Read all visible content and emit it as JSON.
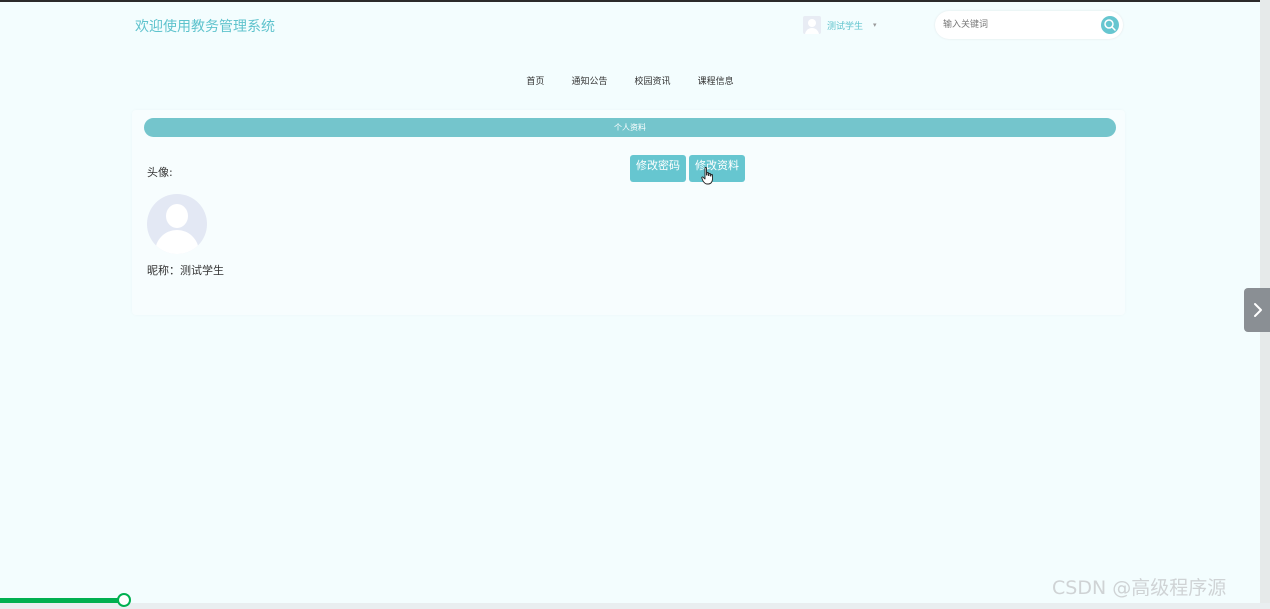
{
  "header": {
    "site_title": "欢迎使用教务管理系统",
    "user_name": "测试学生",
    "user_caret": "▾",
    "search_placeholder": "输入关键词"
  },
  "nav": {
    "items": [
      "首页",
      "通知公告",
      "校园资讯",
      "课程信息"
    ]
  },
  "profile": {
    "section_title": "个人资料",
    "avatar_label": "头像:",
    "nickname_text": "昵称：测试学生",
    "change_password_label": "修改密码",
    "edit_profile_label": "修改资料"
  },
  "video": {
    "progress_percent": 9.8
  },
  "watermark": "CSDN @高级程序源",
  "colors": {
    "accent": "#66c6d0",
    "header_bar": "#74c5cc",
    "background": "#f3fdfe",
    "progress": "#00b050"
  },
  "icons": [
    "user-avatar-icon",
    "search-icon",
    "cursor-hand-icon",
    "chevron-right-icon"
  ]
}
